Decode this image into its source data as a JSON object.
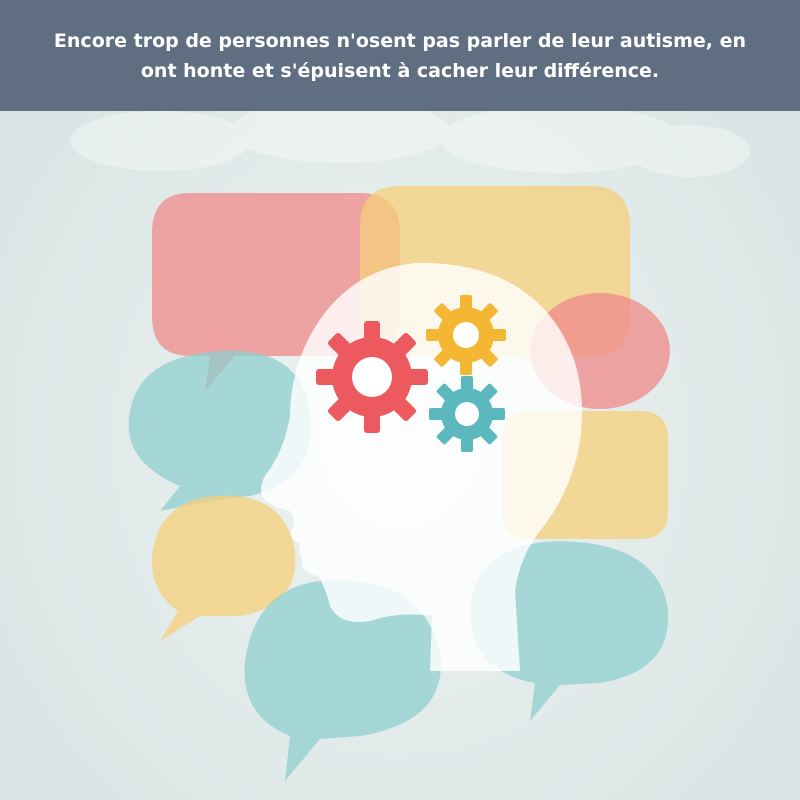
{
  "header": {
    "caption": "Encore trop de personnes n'osent pas parler de leur autisme, en ont honte et s'épuisent à cacher leur différence."
  },
  "illustration": {
    "subject": "head-silhouette-with-gears",
    "colors": {
      "header_background": "#5f6f81",
      "bubble_red": "#f08a8a",
      "bubble_yellow": "#f6cf7a",
      "bubble_teal": "#8fcfcf",
      "head": "#ffffff",
      "gear_red": "#ec5a5f",
      "gear_yellow": "#f3b733",
      "gear_teal": "#5bb8bf"
    },
    "icons": [
      "speech-bubble-icon",
      "head-silhouette-icon",
      "gear-icon"
    ]
  }
}
